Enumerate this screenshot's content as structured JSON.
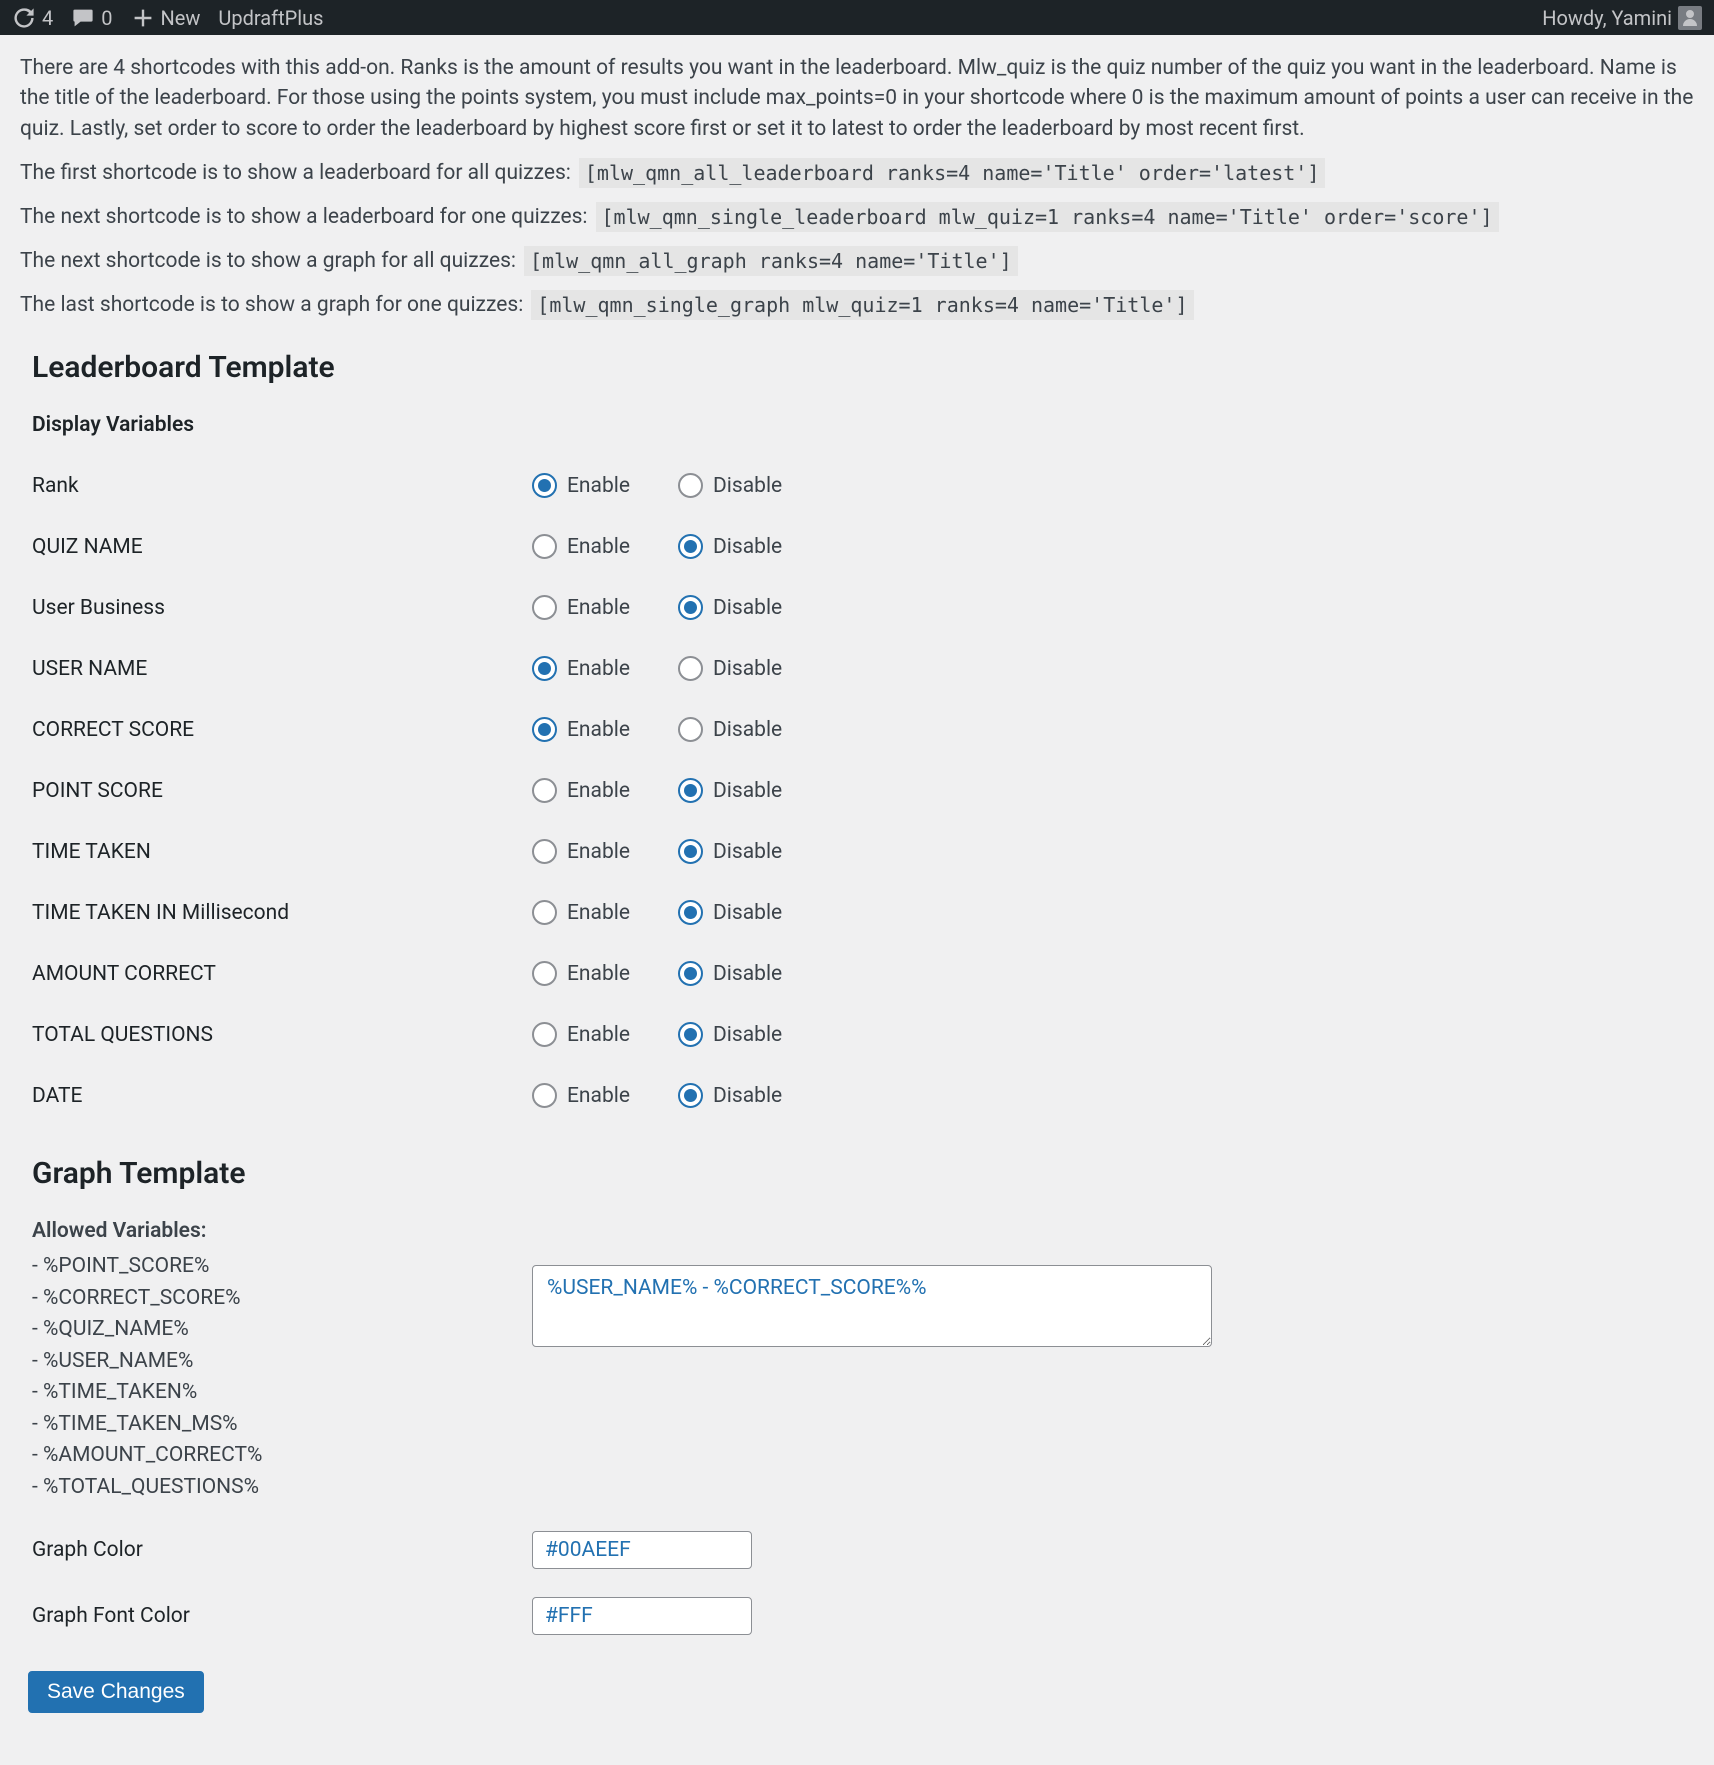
{
  "admin_bar": {
    "updates_count": "4",
    "comments_count": "0",
    "new_label": "New",
    "updraft_label": "UpdraftPlus",
    "howdy": "Howdy, Yamini"
  },
  "intro": {
    "paragraph": "There are 4 shortcodes with this add-on. Ranks is the amount of results you want in the leaderboard. Mlw_quiz is the quiz number of the quiz you want in the leaderboard. Name is the title of the leaderboard. For those using the points system, you must include max_points=0 in your shortcode where 0 is the maximum amount of points a user can receive in the quiz. Lastly, set order to score to order the leaderboard by highest score first or set it to latest to order the leaderboard by most recent first.",
    "line1_label": "The first shortcode is to show a leaderboard for all quizzes:",
    "line1_code": "[mlw_qmn_all_leaderboard ranks=4 name='Title' order='latest']",
    "line2_label": "The next shortcode is to show a leaderboard for one quizzes:",
    "line2_code": "[mlw_qmn_single_leaderboard mlw_quiz=1 ranks=4 name='Title' order='score']",
    "line3_label": "The next shortcode is to show a graph for all quizzes:",
    "line3_code": "[mlw_qmn_all_graph ranks=4 name='Title']",
    "line4_label": "The last shortcode is to show a graph for one quizzes:",
    "line4_code": "[mlw_qmn_single_graph mlw_quiz=1 ranks=4 name='Title']"
  },
  "leaderboard": {
    "title": "Leaderboard Template",
    "subtitle": "Display Variables",
    "enable_label": "Enable",
    "disable_label": "Disable",
    "rows": [
      {
        "label": "Rank",
        "value": "enable"
      },
      {
        "label": "QUIZ NAME",
        "value": "disable"
      },
      {
        "label": "User Business",
        "value": "disable"
      },
      {
        "label": "USER NAME",
        "value": "enable"
      },
      {
        "label": "CORRECT SCORE",
        "value": "enable"
      },
      {
        "label": "POINT SCORE",
        "value": "disable"
      },
      {
        "label": "TIME TAKEN",
        "value": "disable"
      },
      {
        "label": "TIME TAKEN IN Millisecond",
        "value": "disable"
      },
      {
        "label": "AMOUNT CORRECT",
        "value": "disable"
      },
      {
        "label": "TOTAL QUESTIONS",
        "value": "disable"
      },
      {
        "label": "DATE",
        "value": "disable"
      }
    ]
  },
  "graph": {
    "title": "Graph Template",
    "allowed_title": "Allowed Variables:",
    "allowed_vars": [
      "- %POINT_SCORE%",
      "- %CORRECT_SCORE%",
      "- %QUIZ_NAME%",
      "- %USER_NAME%",
      "- %TIME_TAKEN%",
      "- %TIME_TAKEN_MS%",
      "- %AMOUNT_CORRECT%",
      "- %TOTAL_QUESTIONS%"
    ],
    "template_value": "%USER_NAME% - %CORRECT_SCORE%%",
    "color_label": "Graph Color",
    "color_value": "#00AEEF",
    "font_color_label": "Graph Font Color",
    "font_color_value": "#FFF"
  },
  "save_label": "Save Changes"
}
